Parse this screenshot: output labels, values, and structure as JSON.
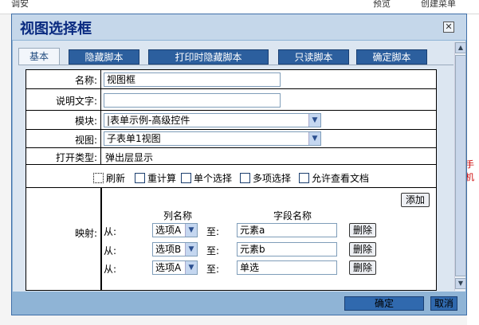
{
  "background": {
    "title_fragment": "调安",
    "preview_label": "预览",
    "new_menu_label": "创建菜单",
    "right_label": "手机"
  },
  "dialog": {
    "title": "视图选择框",
    "close_glyph": "✕"
  },
  "tabs": {
    "active": "基本",
    "others": [
      "隐藏脚本",
      "打印时隐藏脚本",
      "只读脚本",
      "确定脚本"
    ]
  },
  "form": {
    "name_label": "名称:",
    "name_value": "视图框",
    "desc_label": "说明文字:",
    "desc_value": "",
    "module_label": "模块:",
    "module_value": "|表单示例-高级控件",
    "view_label": "视图:",
    "view_value": "子表单1视图",
    "open_type_label": "打开类型:",
    "open_type_value": "弹出层显示",
    "options": [
      "刷新",
      "重计算",
      "单个选择",
      "多项选择",
      "允许查看文档"
    ],
    "mapping_label": "映射:",
    "add_button": "添加",
    "column_header": "列名称",
    "field_header": "字段名称",
    "from_label": "从:",
    "to_label": "至:",
    "delete_button": "删除",
    "mappings": [
      {
        "column": "选项A",
        "field": "元素a"
      },
      {
        "column": "选项B",
        "field": "元素b"
      },
      {
        "column": "选项A",
        "field": "单选"
      }
    ]
  },
  "footer": {
    "ok_label": "确定",
    "cancel_label": "取消"
  },
  "colors": {
    "dialog_frame": "#8fb4d6",
    "title_bar": "#c5d7ea",
    "title_text": "#0a2a80",
    "tab_blue": "#2c5f9e",
    "button_blue": "#3069ae"
  }
}
